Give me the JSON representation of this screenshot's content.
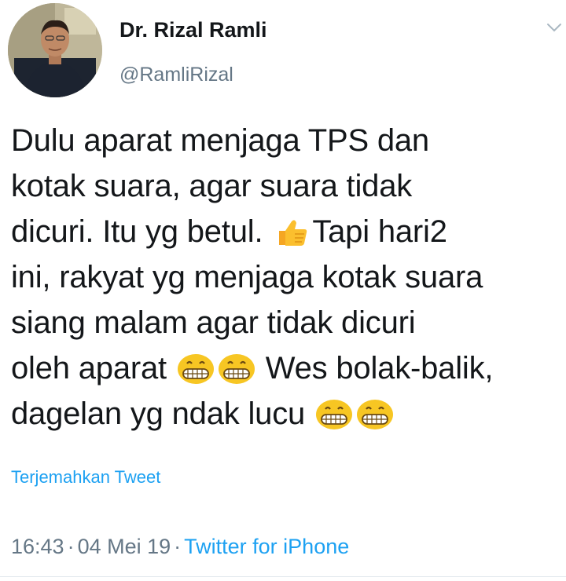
{
  "author": {
    "display_name": "Dr. Rizal Ramli",
    "handle": "@RamliRizal"
  },
  "tweet": {
    "lines": [
      {
        "parts": [
          {
            "t": "Dulu aparat menjaga TPS dan"
          }
        ]
      },
      {
        "parts": [
          {
            "t": "kotak suara, agar suara tidak"
          }
        ]
      },
      {
        "parts": [
          {
            "t": "dicuri. Itu yg betul. "
          },
          {
            "emoji": "thumbs-up-icon"
          },
          {
            "t": "Tapi hari2"
          }
        ]
      },
      {
        "parts": [
          {
            "t": "ini, rakyat yg menjaga kotak suara"
          }
        ]
      },
      {
        "parts": [
          {
            "t": "siang malam agar tidak dicuri"
          }
        ]
      },
      {
        "parts": [
          {
            "t": "oleh aparat "
          },
          {
            "emoji": "grin-icon"
          },
          {
            "emoji": "grin-icon"
          },
          {
            "t": " Wes bolak-balik,"
          }
        ]
      },
      {
        "parts": [
          {
            "t": "dagelan yg ndak lucu "
          },
          {
            "emoji": "grin-icon"
          },
          {
            "emoji": "grin-icon"
          }
        ]
      }
    ],
    "translate_label": "Terjemahkan Tweet"
  },
  "meta": {
    "time": "16:43",
    "separator": "·",
    "date": "04 Mei 19",
    "source": "Twitter for iPhone"
  },
  "colors": {
    "link": "#1da1f2",
    "secondary_text": "#657786",
    "primary_text": "#14171a"
  }
}
